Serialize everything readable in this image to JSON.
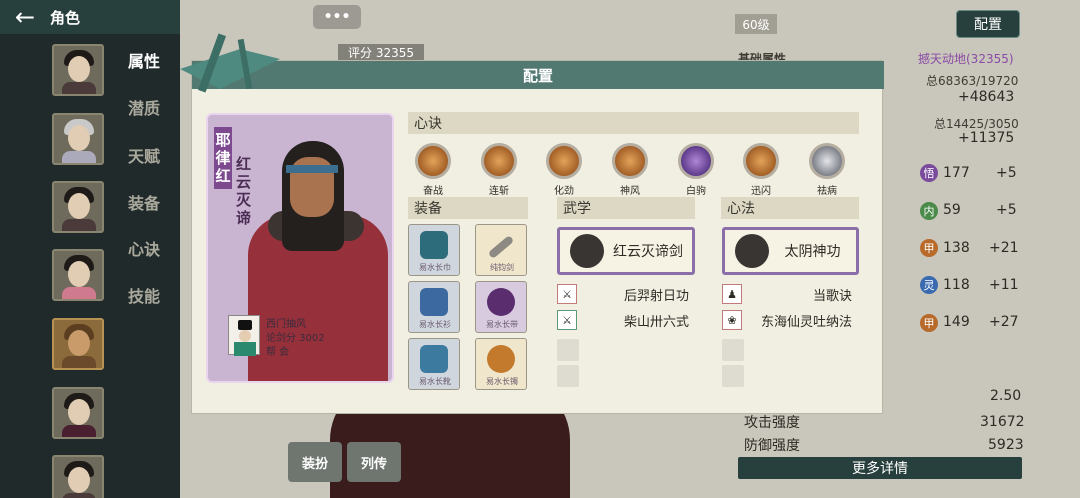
{
  "header": {
    "title": "角色",
    "chat_label": "•••",
    "level": "60级",
    "config_button": "配置"
  },
  "tabs": [
    {
      "label": "属性"
    },
    {
      "label": "潜质"
    },
    {
      "label": "天赋"
    },
    {
      "label": "装备"
    },
    {
      "label": "心诀"
    },
    {
      "label": "技能"
    }
  ],
  "score": "评分 32355",
  "right_panel": {
    "base_label": "基础属性",
    "link": "撼天动地(32355)",
    "total1": "总68363/19720",
    "val1": "+48643",
    "total2": "总14425/3050",
    "val2": "+11375",
    "rows": [
      {
        "icon": "悟",
        "val": "177",
        "bonus": "+5"
      },
      {
        "icon": "内",
        "val": "59",
        "bonus": "+5"
      },
      {
        "icon": "甲",
        "val": "138",
        "bonus": "+21"
      },
      {
        "icon": "灵",
        "val": "118",
        "bonus": "+11"
      },
      {
        "icon": "甲",
        "val": "149",
        "bonus": "+27"
      }
    ],
    "stat_value": "2.50",
    "attack_label": "攻击强度",
    "attack_value": "31672",
    "defense_label": "防御强度",
    "defense_value": "5923",
    "detail_button": "更多详情"
  },
  "bottom": {
    "btn1": "装扮",
    "btn2": "列传"
  },
  "modal": {
    "title": "配置",
    "card": {
      "name": "耶律红",
      "skill": "红云灭谛",
      "owner_name": "西门抽风",
      "owner_score": "论剑分 3002",
      "owner_guild": "帮   会"
    },
    "xinjue_label": "心诀",
    "xinjue": [
      {
        "label": "奋战",
        "color": "gold"
      },
      {
        "label": "连斩",
        "color": "gold"
      },
      {
        "label": "化劲",
        "color": "gold"
      },
      {
        "label": "神风",
        "color": "gold"
      },
      {
        "label": "白驹",
        "color": "purple"
      },
      {
        "label": "迅闪",
        "color": "gold"
      },
      {
        "label": "祛病",
        "color": "silver"
      }
    ],
    "equip_label": "装备",
    "equip": [
      {
        "label": "易水长巾",
        "type": "blue"
      },
      {
        "label": "纯钧剑",
        "type": "gold"
      },
      {
        "label": "易水长衫",
        "type": "blue"
      },
      {
        "label": "易水长带",
        "type": "purple"
      },
      {
        "label": "易水长靴",
        "type": "blue"
      },
      {
        "label": "易水长镯",
        "type": "gold"
      }
    ],
    "wuxue_label": "武学",
    "wuxue_main": "红云灭谛剑",
    "wuxue_subs": [
      "后羿射日功",
      "柴山卅六式"
    ],
    "xinfa_label": "心法",
    "xinfa_main": "太阴神功",
    "xinfa_subs": [
      "当歌诀",
      "东海仙灵吐纳法"
    ]
  }
}
